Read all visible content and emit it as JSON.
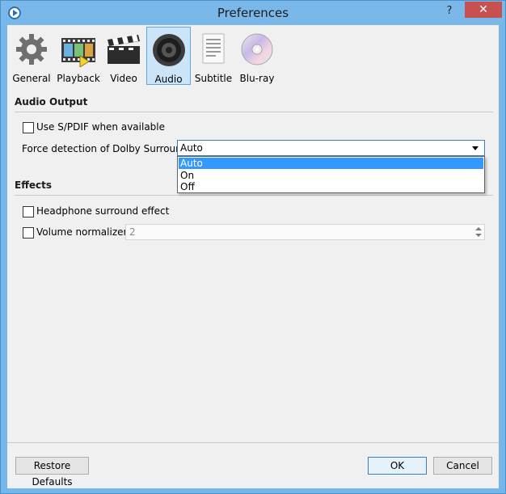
{
  "window": {
    "title": "Preferences",
    "help_label": "?",
    "close_label": "✕"
  },
  "toolbar": {
    "items": [
      {
        "label": "General",
        "icon": "gear-icon"
      },
      {
        "label": "Playback",
        "icon": "film-icon"
      },
      {
        "label": "Video",
        "icon": "clapperboard-icon"
      },
      {
        "label": "Audio",
        "icon": "speaker-icon",
        "active": true
      },
      {
        "label": "Subtitle",
        "icon": "document-icon"
      },
      {
        "label": "Blu-ray",
        "icon": "disc-icon"
      }
    ]
  },
  "audio_output": {
    "title": "Audio Output",
    "spdif_label": "Use S/PDIF when available",
    "spdif_checked": false,
    "dolby_label": "Force detection of Dolby Surround:",
    "dolby_value": "Auto",
    "dolby_options": [
      "Auto",
      "On",
      "Off"
    ]
  },
  "effects": {
    "title": "Effects",
    "headphone_label": "Headphone surround effect",
    "headphone_checked": false,
    "normalizer_label": "Volume normalizer",
    "normalizer_checked": false,
    "normalizer_value": "2"
  },
  "buttons": {
    "restore": "Restore Defaults",
    "ok": "OK",
    "cancel": "Cancel"
  },
  "colors": {
    "accent": "#3399ff",
    "titlebar": "#7ab8ea",
    "close": "#c75050"
  }
}
